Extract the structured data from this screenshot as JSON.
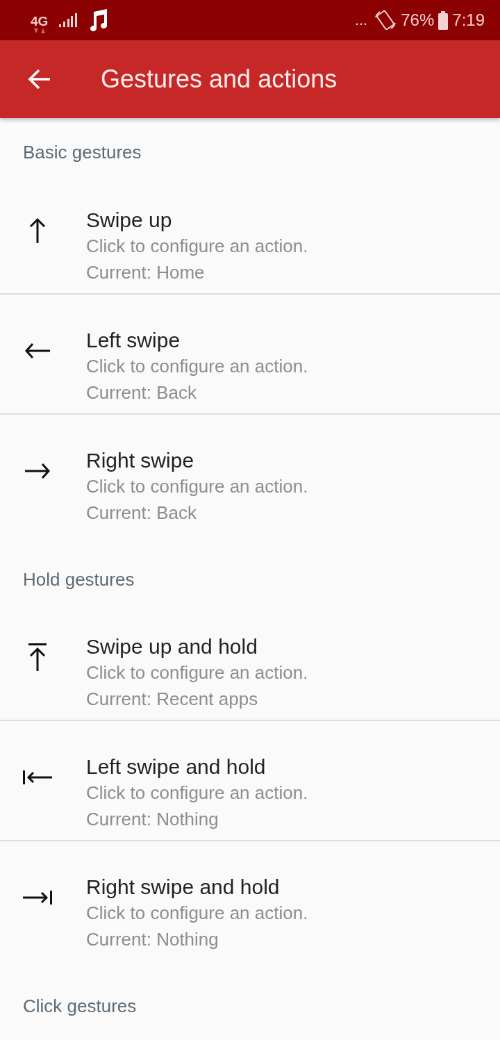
{
  "status_bar": {
    "network": "4G",
    "more": "...",
    "battery": "76%",
    "time": "7:19"
  },
  "app_bar": {
    "title": "Gestures and actions"
  },
  "sections": [
    {
      "title": "Basic gestures",
      "items": [
        {
          "kind": "up",
          "title": "Swipe up",
          "summary": "Click to configure an action.",
          "current": "Current: Home"
        },
        {
          "kind": "left",
          "title": "Left swipe",
          "summary": "Click to configure an action.",
          "current": "Current: Back"
        },
        {
          "kind": "right",
          "title": "Right swipe",
          "summary": "Click to configure an action.",
          "current": "Current: Back"
        }
      ]
    },
    {
      "title": "Hold gestures",
      "items": [
        {
          "kind": "up_hold",
          "title": "Swipe up and hold",
          "summary": "Click to configure an action.",
          "current": "Current: Recent apps"
        },
        {
          "kind": "left_hold",
          "title": "Left swipe and hold",
          "summary": "Click to configure an action.",
          "current": "Current: Nothing"
        },
        {
          "kind": "right_hold",
          "title": "Right swipe and hold",
          "summary": "Click to configure an action.",
          "current": "Current: Nothing"
        }
      ]
    },
    {
      "title": "Click gestures"
    }
  ]
}
